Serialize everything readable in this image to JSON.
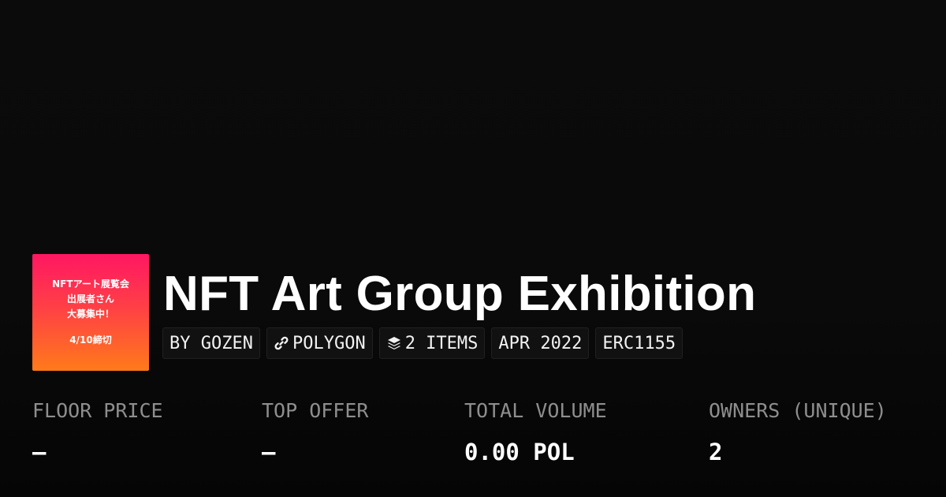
{
  "thumbnail": {
    "lines": [
      "NFTアート展覧会",
      "出展者さん",
      "大募集中！",
      "4/10締切"
    ],
    "gradient_colors": [
      "#ff1762",
      "#ff7a1a"
    ]
  },
  "collection": {
    "title": "NFT Art Group Exhibition"
  },
  "chips": {
    "creator": "BY GOZEN",
    "chain": "POLYGON",
    "chain_icon": "link-icon",
    "items": "2 ITEMS",
    "items_icon": "layers-icon",
    "date": "APR 2022",
    "standard": "ERC1155"
  },
  "stats": {
    "floor_price": {
      "label": "FLOOR PRICE",
      "value": "–"
    },
    "top_offer": {
      "label": "TOP OFFER",
      "value": "–"
    },
    "total_volume": {
      "label": "TOTAL VOLUME",
      "value": "0.00 POL"
    },
    "owners": {
      "label": "OWNERS (UNIQUE)",
      "value": "2"
    }
  },
  "colors": {
    "background": "#0b0b0b",
    "label": "#8e8e8e",
    "chip_bg": "#111111"
  }
}
